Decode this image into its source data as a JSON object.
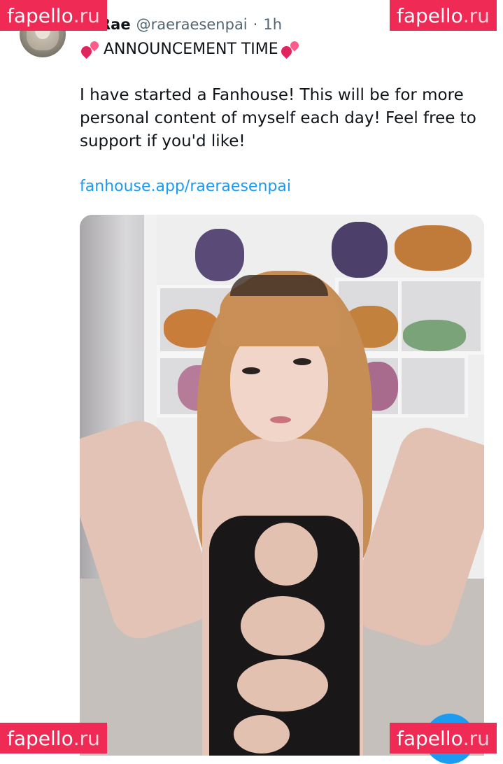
{
  "post": {
    "display_name": "Rae",
    "handle": "@raeraesenpai",
    "separator": "·",
    "time": "1h",
    "announcement": "ANNOUNCEMENT TIME",
    "body": "I have started a Fanhouse! This will be for more personal content of myself each day! Feel free to support if you'd like!",
    "link_text": "fanhouse.app/raeraesenpai",
    "media_icon": "photo"
  },
  "watermark": {
    "brand": "fapello",
    "tld": ".ru",
    "color": "#ee2a55"
  },
  "colors": {
    "link": "#1d9bf0",
    "heart": "#e0245e",
    "secondary_text": "#536471"
  }
}
